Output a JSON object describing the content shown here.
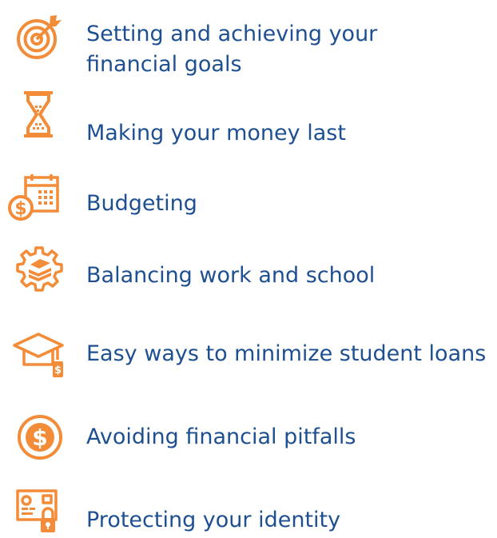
{
  "accent_color": "#f28c38",
  "text_color": "#1d4f91",
  "topics": [
    {
      "label_line1": "Setting and achieving your",
      "label_line2": "financial goals",
      "icon": "target-icon"
    },
    {
      "label": "Making your money last",
      "icon": "hourglass-icon"
    },
    {
      "label": "Budgeting",
      "icon": "calendar-dollar-icon"
    },
    {
      "label": "Balancing work and school",
      "icon": "gear-books-icon"
    },
    {
      "label": "Easy ways to minimize student loans",
      "icon": "graduation-cap-dollar-icon"
    },
    {
      "label": "Avoiding financial pitfalls",
      "icon": "dollar-circle-icon"
    },
    {
      "label": "Protecting your identity",
      "icon": "id-card-lock-icon"
    }
  ]
}
